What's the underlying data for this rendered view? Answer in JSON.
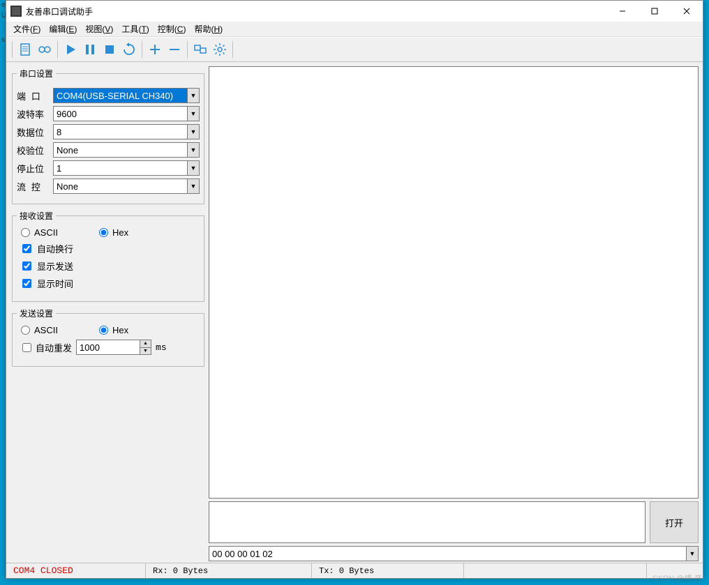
{
  "window": {
    "title": "友善串口调试助手"
  },
  "menu": {
    "file": {
      "label": "文件",
      "hotkey": "F"
    },
    "edit": {
      "label": "编辑",
      "hotkey": "E"
    },
    "view": {
      "label": "视图",
      "hotkey": "V"
    },
    "tools": {
      "label": "工具",
      "hotkey": "T"
    },
    "control": {
      "label": "控制",
      "hotkey": "C"
    },
    "help": {
      "label": "帮助",
      "hotkey": "H"
    }
  },
  "toolbar_icons": {
    "new": "new-doc-icon",
    "record": "record-icon",
    "play": "play-icon",
    "pause": "pause-icon",
    "stop": "stop-icon",
    "refresh": "refresh-icon",
    "add": "plus-icon",
    "remove": "minus-icon",
    "windows": "windows-icon",
    "settings": "gear-icon"
  },
  "groups": {
    "port": {
      "legend": "串口设置"
    },
    "recv": {
      "legend": "接收设置"
    },
    "send": {
      "legend": "发送设置"
    }
  },
  "port": {
    "port_label": "端  口",
    "port_value": "COM4(USB-SERIAL CH340)",
    "baud_label": "波特率",
    "baud_value": "9600",
    "data_label": "数据位",
    "data_value": "8",
    "parity_label": "校验位",
    "parity_value": "None",
    "stop_label": "停止位",
    "stop_value": "1",
    "flow_label": "流  控",
    "flow_value": "None"
  },
  "recv": {
    "ascii_label": "ASCII",
    "hex_label": "Hex",
    "mode_selected": "hex",
    "wrap_label": "自动换行",
    "wrap_checked": true,
    "showtx_label": "显示发送",
    "showtx_checked": true,
    "showtime_label": "显示时间",
    "showtime_checked": true
  },
  "send": {
    "ascii_label": "ASCII",
    "hex_label": "Hex",
    "mode_selected": "hex",
    "auto_label": "自动重发",
    "auto_checked": false,
    "interval_value": "1000",
    "interval_unit": "ms"
  },
  "rx_text": "",
  "tx_text": "",
  "open_btn": "打开",
  "hex_line": "00 00 00 01 02",
  "status": {
    "port": "COM4 CLOSED",
    "rx": "Rx: 0 Bytes",
    "tx": "Tx: 0 Bytes"
  },
  "watermark": "CSDN @博-彦"
}
